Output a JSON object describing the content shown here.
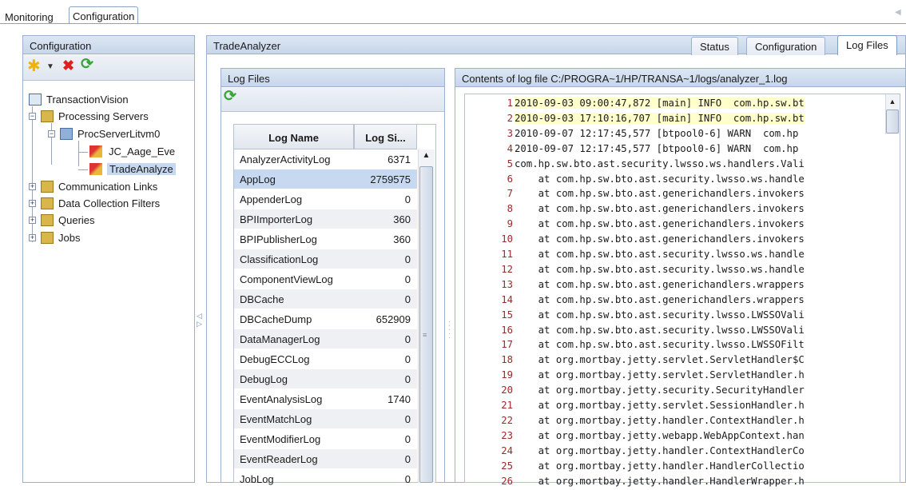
{
  "top_tabs": [
    "Monitoring",
    "Configuration"
  ],
  "left_panel": {
    "title": "Configuration",
    "tree": [
      {
        "label": "TransactionVision"
      },
      {
        "label": "Processing Servers"
      },
      {
        "label": "ProcServerLitvm0"
      },
      {
        "label": "JC_Aage_Eve"
      },
      {
        "label": "TradeAnalyze"
      },
      {
        "label": "Communication Links"
      },
      {
        "label": "Data Collection Filters"
      },
      {
        "label": "Queries"
      },
      {
        "label": "Jobs"
      }
    ]
  },
  "right_panel": {
    "title": "TradeAnalyzer",
    "tabs": [
      "Status",
      "Configuration",
      "Log Files"
    ],
    "active_tab": "Log Files"
  },
  "log_files": {
    "title": "Log Files",
    "columns": [
      "Log Name",
      "Log Si..."
    ],
    "rows": [
      {
        "name": "AnalyzerActivityLog",
        "size": "6371"
      },
      {
        "name": "AppLog",
        "size": "2759575"
      },
      {
        "name": "AppenderLog",
        "size": "0"
      },
      {
        "name": "BPIImporterLog",
        "size": "360"
      },
      {
        "name": "BPIPublisherLog",
        "size": "360"
      },
      {
        "name": "ClassificationLog",
        "size": "0"
      },
      {
        "name": "ComponentViewLog",
        "size": "0"
      },
      {
        "name": "DBCache",
        "size": "0"
      },
      {
        "name": "DBCacheDump",
        "size": "652909"
      },
      {
        "name": "DataManagerLog",
        "size": "0"
      },
      {
        "name": "DebugECCLog",
        "size": "0"
      },
      {
        "name": "DebugLog",
        "size": "0"
      },
      {
        "name": "EventAnalysisLog",
        "size": "1740"
      },
      {
        "name": "EventMatchLog",
        "size": "0"
      },
      {
        "name": "EventModifierLog",
        "size": "0"
      },
      {
        "name": "EventReaderLog",
        "size": "0"
      },
      {
        "name": "JobLog",
        "size": "0"
      }
    ]
  },
  "log_content": {
    "title": "Contents of log file C:/PROGRA~1/HP/TRANSA~1/logs/analyzer_1.log",
    "lines": [
      {
        "n": "1",
        "t": "2010-09-03 09:00:47,872 [main] INFO  com.hp.sw.bt"
      },
      {
        "n": "2",
        "t": "2010-09-03 17:10:16,707 [main] INFO  com.hp.sw.bt"
      },
      {
        "n": "3",
        "t": "2010-09-07 12:17:45,577 [btpool0-6] WARN  com.hp"
      },
      {
        "n": "4",
        "t": "2010-09-07 12:17:45,577 [btpool0-6] WARN  com.hp"
      },
      {
        "n": "5",
        "t": "com.hp.sw.bto.ast.security.lwsso.ws.handlers.Vali"
      },
      {
        "n": "6",
        "t": "    at com.hp.sw.bto.ast.security.lwsso.ws.handle"
      },
      {
        "n": "7",
        "t": "    at com.hp.sw.bto.ast.generichandlers.invokers"
      },
      {
        "n": "8",
        "t": "    at com.hp.sw.bto.ast.generichandlers.invokers"
      },
      {
        "n": "9",
        "t": "    at com.hp.sw.bto.ast.generichandlers.invokers"
      },
      {
        "n": "10",
        "t": "    at com.hp.sw.bto.ast.generichandlers.invokers"
      },
      {
        "n": "11",
        "t": "    at com.hp.sw.bto.ast.security.lwsso.ws.handle"
      },
      {
        "n": "12",
        "t": "    at com.hp.sw.bto.ast.security.lwsso.ws.handle"
      },
      {
        "n": "13",
        "t": "    at com.hp.sw.bto.ast.generichandlers.wrappers"
      },
      {
        "n": "14",
        "t": "    at com.hp.sw.bto.ast.generichandlers.wrappers"
      },
      {
        "n": "15",
        "t": "    at com.hp.sw.bto.ast.security.lwsso.LWSSOVali"
      },
      {
        "n": "16",
        "t": "    at com.hp.sw.bto.ast.security.lwsso.LWSSOVali"
      },
      {
        "n": "17",
        "t": "    at com.hp.sw.bto.ast.security.lwsso.LWSSOFilt"
      },
      {
        "n": "18",
        "t": "    at org.mortbay.jetty.servlet.ServletHandler$C"
      },
      {
        "n": "19",
        "t": "    at org.mortbay.jetty.servlet.ServletHandler.h"
      },
      {
        "n": "20",
        "t": "    at org.mortbay.jetty.security.SecurityHandler"
      },
      {
        "n": "21",
        "t": "    at org.mortbay.jetty.servlet.SessionHandler.h"
      },
      {
        "n": "22",
        "t": "    at org.mortbay.jetty.handler.ContextHandler.h"
      },
      {
        "n": "23",
        "t": "    at org.mortbay.jetty.webapp.WebAppContext.han"
      },
      {
        "n": "24",
        "t": "    at org.mortbay.jetty.handler.ContextHandlerCo"
      },
      {
        "n": "25",
        "t": "    at org.mortbay.jetty.handler.HandlerCollectio"
      },
      {
        "n": "26",
        "t": "    at org.mortbay.jetty.handler.HandlerWrapper.h"
      }
    ]
  },
  "icons": {
    "new": "asterisk-new-icon",
    "delete": "red-x-delete-icon",
    "refresh": "green-refresh-icon"
  },
  "colors": {
    "header_blue": "#c7d6ea",
    "selected_row": "#c6d9f1",
    "line_number_red": "#9a2b2b"
  }
}
